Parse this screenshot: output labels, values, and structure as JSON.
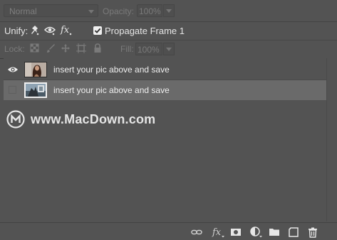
{
  "blend_mode": {
    "value": "Normal"
  },
  "opacity": {
    "label": "Opacity:",
    "value": "100%"
  },
  "unify": {
    "label": "Unify:",
    "icons": [
      "unify-position-icon",
      "unify-visibility-icon",
      "unify-style-icon"
    ]
  },
  "propagate": {
    "label": "Propagate Frame 1",
    "checked": true
  },
  "lock": {
    "label": "Lock:",
    "icons": [
      "lock-transparent-pixels-icon",
      "lock-image-pixels-icon",
      "lock-position-icon",
      "lock-artboard-icon",
      "lock-all-icon"
    ]
  },
  "fill": {
    "label": "Fill:",
    "value": "100%"
  },
  "layers": [
    {
      "name": "insert your pic above and save",
      "visible": true,
      "selected": false
    },
    {
      "name": "insert your pic above and save",
      "visible": false,
      "selected": true
    }
  ],
  "watermark": {
    "text": "www.MacDown.com"
  },
  "bottom_toolbar": {
    "icons": [
      "link-layers-icon",
      "fx-icon",
      "add-mask-icon",
      "adjustment-layer-icon",
      "new-group-icon",
      "new-layer-icon",
      "delete-layer-icon"
    ]
  },
  "colors": {
    "panel": "#535353",
    "selected_row": "#6a6a6a",
    "text": "#efefef",
    "disabled_text": "#7a7a7a"
  }
}
